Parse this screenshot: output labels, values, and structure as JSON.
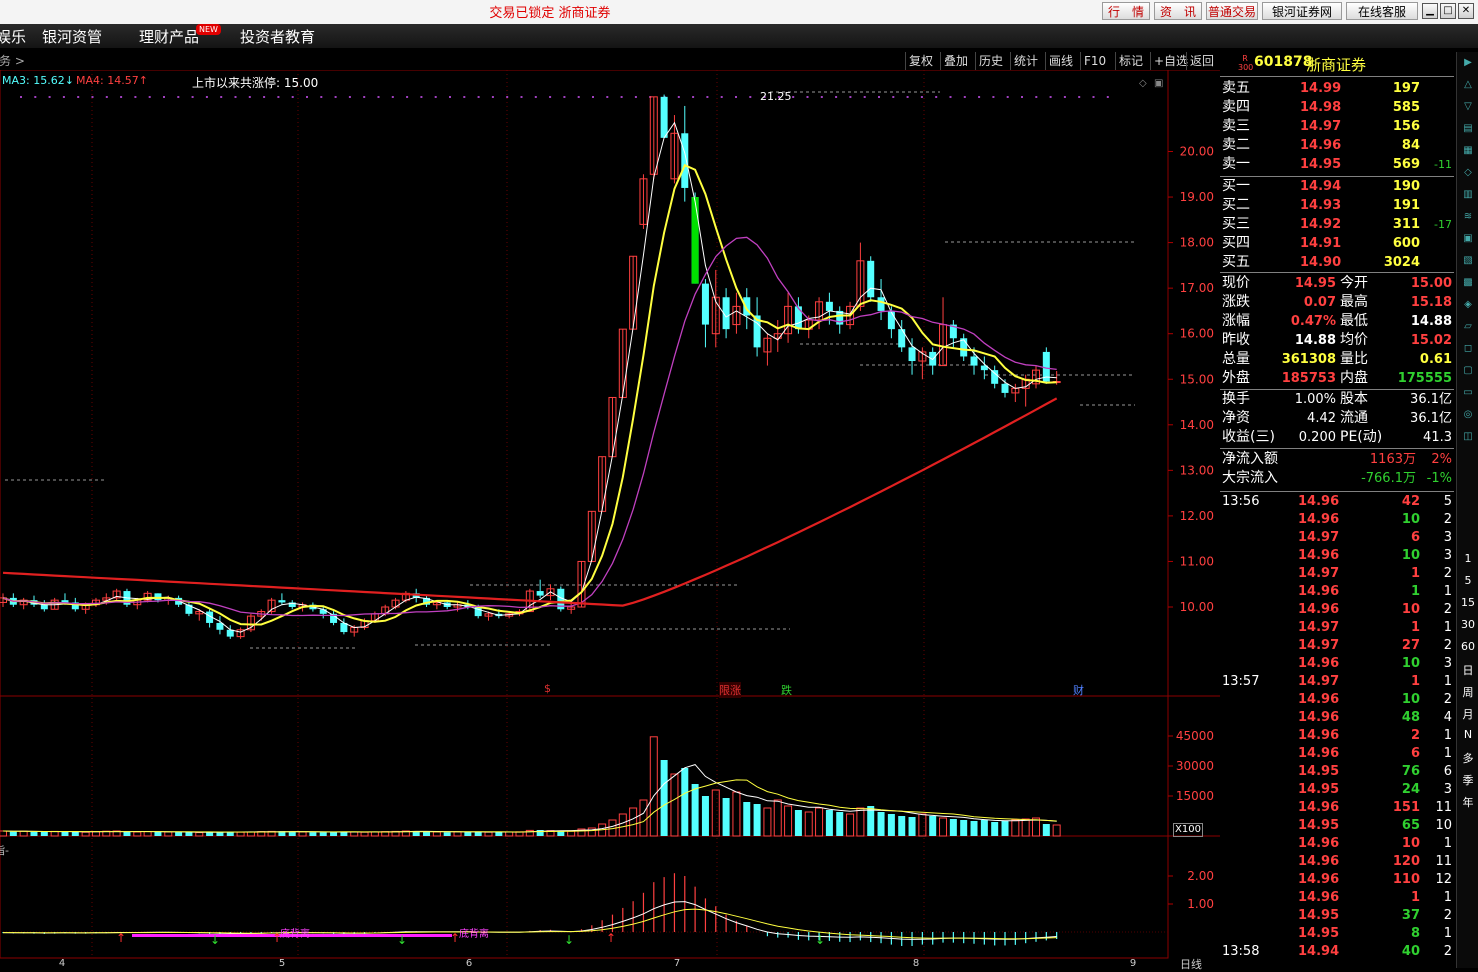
{
  "window": {
    "title": "交易已锁定  浙商证券",
    "buttons": [
      "行　情",
      "资　讯",
      "普通交易",
      "银河证券网",
      "在线客服"
    ]
  },
  "menu": {
    "items": [
      "娱乐",
      "银河资管",
      "理财产品",
      "投资者教育"
    ],
    "new_badge": "NEW"
  },
  "toolbar": {
    "left": "务 >",
    "items": [
      "复权",
      "叠加",
      "历史",
      "统计",
      "画线",
      "F10",
      "标记",
      "+自选",
      "返回"
    ]
  },
  "indicators": {
    "ma3": "MA3: 15.62",
    "ma3_arrow": "↓",
    "ma4": "MA4: 14.57",
    "ma4_arrow": "↑",
    "limit_up": "上市以来共涨停: 15.00",
    "peak": "21.25",
    "volume_unit": "X100",
    "macd_label": "指-",
    "period": "日线"
  },
  "events": [
    {
      "label": "$",
      "color": "#e03030"
    },
    {
      "label": "限涨",
      "color": "#e03030"
    },
    {
      "label": "跌",
      "color": "#30d030"
    },
    {
      "label": "财",
      "color": "#5080ff"
    }
  ],
  "annotations": [
    "底背离",
    "底背离"
  ],
  "colors": {
    "up": "#ff4040",
    "down": "#54ffff",
    "ma_white": "#ffffff",
    "ma_yellow": "#ffff40",
    "ma_magenta": "#c040c0",
    "ma_red": "#e02020"
  },
  "chart_data": {
    "type": "candlestick",
    "price_axis": {
      "ticks": [
        "20.00",
        "19.00",
        "18.00",
        "17.00",
        "16.00",
        "15.00",
        "14.00",
        "13.00",
        "12.00",
        "11.00",
        "10.00"
      ]
    },
    "volume_axis": {
      "ticks": [
        "45000",
        "30000",
        "15000"
      ]
    },
    "macd_axis": {
      "ticks": [
        "2.00",
        "1.00"
      ]
    },
    "x_labels": [
      "4",
      "5",
      "6",
      "7",
      "8",
      "9"
    ],
    "candles": [
      [
        10.1,
        10.3,
        10.0,
        10.2
      ],
      [
        10.2,
        10.3,
        10.0,
        10.05
      ],
      [
        10.05,
        10.2,
        9.95,
        10.15
      ],
      [
        10.15,
        10.25,
        10.0,
        10.05
      ],
      [
        10.05,
        10.15,
        9.9,
        9.95
      ],
      [
        9.95,
        10.2,
        9.95,
        10.15
      ],
      [
        10.15,
        10.3,
        10.05,
        10.1
      ],
      [
        10.1,
        10.2,
        9.9,
        9.95
      ],
      [
        9.95,
        10.1,
        9.85,
        10.05
      ],
      [
        10.05,
        10.2,
        10.0,
        10.15
      ],
      [
        10.15,
        10.3,
        10.05,
        10.2
      ],
      [
        10.2,
        10.4,
        10.15,
        10.35
      ],
      [
        10.35,
        10.4,
        10.0,
        10.05
      ],
      [
        10.05,
        10.2,
        9.95,
        10.15
      ],
      [
        10.15,
        10.35,
        10.1,
        10.3
      ],
      [
        10.3,
        10.3,
        10.1,
        10.15
      ],
      [
        10.15,
        10.25,
        10.05,
        10.2
      ],
      [
        10.2,
        10.25,
        10.0,
        10.05
      ],
      [
        10.05,
        10.1,
        9.8,
        9.85
      ],
      [
        9.85,
        9.95,
        9.7,
        9.9
      ],
      [
        9.9,
        9.95,
        9.55,
        9.65
      ],
      [
        9.65,
        9.8,
        9.4,
        9.5
      ],
      [
        9.5,
        9.6,
        9.3,
        9.35
      ],
      [
        9.35,
        9.55,
        9.3,
        9.5
      ],
      [
        9.5,
        9.85,
        9.45,
        9.8
      ],
      [
        9.8,
        9.95,
        9.7,
        9.9
      ],
      [
        9.9,
        10.2,
        9.85,
        10.15
      ],
      [
        10.15,
        10.3,
        10.05,
        10.1
      ],
      [
        10.1,
        10.15,
        9.95,
        10.0
      ],
      [
        10.0,
        10.1,
        9.9,
        10.05
      ],
      [
        10.05,
        10.1,
        9.9,
        9.95
      ],
      [
        9.95,
        10.0,
        9.75,
        9.85
      ],
      [
        9.85,
        9.95,
        9.6,
        9.65
      ],
      [
        9.65,
        9.75,
        9.4,
        9.45
      ],
      [
        9.45,
        9.6,
        9.35,
        9.55
      ],
      [
        9.55,
        9.75,
        9.5,
        9.7
      ],
      [
        9.7,
        9.9,
        9.65,
        9.85
      ],
      [
        9.85,
        10.05,
        9.8,
        10.0
      ],
      [
        10.0,
        10.2,
        9.95,
        10.15
      ],
      [
        10.15,
        10.35,
        10.1,
        10.3
      ],
      [
        10.3,
        10.4,
        10.1,
        10.2
      ],
      [
        10.2,
        10.25,
        10.0,
        10.05
      ],
      [
        10.05,
        10.15,
        9.95,
        10.1
      ],
      [
        10.1,
        10.15,
        9.95,
        10.0
      ],
      [
        10.0,
        10.1,
        9.9,
        10.05
      ],
      [
        10.05,
        10.15,
        9.95,
        10.0
      ],
      [
        10.0,
        10.05,
        9.75,
        9.8
      ],
      [
        9.8,
        9.9,
        9.7,
        9.85
      ],
      [
        9.85,
        9.95,
        9.75,
        9.8
      ],
      [
        9.8,
        9.9,
        9.75,
        9.85
      ],
      [
        9.85,
        9.95,
        9.8,
        9.9
      ],
      [
        9.9,
        10.4,
        9.9,
        10.35
      ],
      [
        10.35,
        10.6,
        10.2,
        10.25
      ],
      [
        10.25,
        10.5,
        10.15,
        10.4
      ],
      [
        10.4,
        10.45,
        9.9,
        9.95
      ],
      [
        9.95,
        10.1,
        9.85,
        10.0
      ],
      [
        10.0,
        11.0,
        10.0,
        11.0
      ],
      [
        11.0,
        12.1,
        11.0,
        12.1
      ],
      [
        12.1,
        13.3,
        12.1,
        13.3
      ],
      [
        13.3,
        14.6,
        13.3,
        14.6
      ],
      [
        14.6,
        16.1,
        14.6,
        16.1
      ],
      [
        16.1,
        17.7,
        16.1,
        17.7
      ],
      [
        18.4,
        19.5,
        18.3,
        19.4
      ],
      [
        19.5,
        21.2,
        19.4,
        21.2
      ],
      [
        21.2,
        21.25,
        20.3,
        20.3
      ],
      [
        19.4,
        20.8,
        19.3,
        20.4
      ],
      [
        20.4,
        21.0,
        18.9,
        19.2
      ],
      [
        19.0,
        19.1,
        17.1,
        17.1
      ],
      [
        17.1,
        17.2,
        15.7,
        16.2
      ],
      [
        16.0,
        17.4,
        15.7,
        16.8
      ],
      [
        16.8,
        17.0,
        15.9,
        16.1
      ],
      [
        16.2,
        16.9,
        16.0,
        16.6
      ],
      [
        16.8,
        17.0,
        16.1,
        16.4
      ],
      [
        16.4,
        16.8,
        15.5,
        15.7
      ],
      [
        15.6,
        16.0,
        15.3,
        15.9
      ],
      [
        15.9,
        16.3,
        15.6,
        16.0
      ],
      [
        16.0,
        16.9,
        15.8,
        16.6
      ],
      [
        16.6,
        16.8,
        16.0,
        16.1
      ],
      [
        16.1,
        16.4,
        15.9,
        16.3
      ],
      [
        16.3,
        16.8,
        16.1,
        16.7
      ],
      [
        16.7,
        16.9,
        16.2,
        16.5
      ],
      [
        16.5,
        16.6,
        16.0,
        16.2
      ],
      [
        16.2,
        16.7,
        16.1,
        16.6
      ],
      [
        16.6,
        18.0,
        16.5,
        17.6
      ],
      [
        17.6,
        17.7,
        16.7,
        16.8
      ],
      [
        16.8,
        17.2,
        16.3,
        16.5
      ],
      [
        16.5,
        16.6,
        15.9,
        16.1
      ],
      [
        16.1,
        16.3,
        15.6,
        15.7
      ],
      [
        15.7,
        15.9,
        15.1,
        15.4
      ],
      [
        15.4,
        15.7,
        15.0,
        15.6
      ],
      [
        15.6,
        15.7,
        15.1,
        15.3
      ],
      [
        15.3,
        16.8,
        15.3,
        16.2
      ],
      [
        16.2,
        16.3,
        15.7,
        15.9
      ],
      [
        15.9,
        16.0,
        15.4,
        15.5
      ],
      [
        15.5,
        15.7,
        15.1,
        15.3
      ],
      [
        15.3,
        15.5,
        15.0,
        15.2
      ],
      [
        15.2,
        15.3,
        14.8,
        14.9
      ],
      [
        14.9,
        15.0,
        14.6,
        14.7
      ],
      [
        14.7,
        14.9,
        14.5,
        14.8
      ],
      [
        14.8,
        15.1,
        14.4,
        15.0
      ],
      [
        14.9,
        15.3,
        14.8,
        15.2
      ],
      [
        15.6,
        15.7,
        14.9,
        14.95
      ],
      [
        14.95,
        15.18,
        14.88,
        14.95
      ]
    ],
    "volumes": [
      25,
      22,
      24,
      21,
      20,
      23,
      24,
      20,
      19,
      22,
      24,
      25,
      21,
      20,
      22,
      21,
      20,
      19,
      18,
      17,
      20,
      22,
      21,
      19,
      20,
      22,
      23,
      24,
      21,
      20,
      19,
      18,
      21,
      22,
      20,
      19,
      20,
      22,
      23,
      25,
      24,
      21,
      20,
      19,
      21,
      22,
      20,
      19,
      18,
      20,
      21,
      28,
      30,
      27,
      26,
      24,
      35,
      40,
      60,
      80,
      110,
      140,
      180,
      496,
      380,
      310,
      340,
      260,
      200,
      230,
      190,
      220,
      170,
      160,
      140,
      180,
      150,
      130,
      120,
      140,
      130,
      120,
      110,
      140,
      150,
      120,
      110,
      100,
      95,
      110,
      100,
      90,
      85,
      80,
      75,
      80,
      70,
      75,
      80,
      85,
      90,
      60,
      55
    ],
    "macd": [
      -0.04,
      -0.05,
      -0.05,
      -0.06,
      -0.07,
      -0.06,
      -0.05,
      -0.06,
      -0.06,
      -0.05,
      -0.04,
      -0.02,
      -0.03,
      -0.03,
      -0.02,
      -0.02,
      -0.02,
      -0.03,
      -0.04,
      -0.05,
      -0.07,
      -0.09,
      -0.11,
      -0.11,
      -0.09,
      -0.07,
      -0.04,
      -0.03,
      -0.03,
      -0.03,
      -0.04,
      -0.05,
      -0.07,
      -0.09,
      -0.09,
      -0.07,
      -0.05,
      -0.02,
      0.01,
      0.03,
      0.03,
      0.02,
      0.02,
      0.01,
      0.01,
      0.01,
      -0.01,
      -0.01,
      -0.02,
      -0.02,
      -0.01,
      0.04,
      0.07,
      0.08,
      0.03,
      0.01,
      0.1,
      0.24,
      0.42,
      0.62,
      0.86,
      1.1,
      1.4,
      1.78,
      1.96,
      2.1,
      2.0,
      1.62,
      1.2,
      0.92,
      0.62,
      0.4,
      0.22,
      0.0,
      -0.15,
      -0.2,
      -0.2,
      -0.28,
      -0.3,
      -0.3,
      -0.32,
      -0.35,
      -0.36,
      -0.3,
      -0.36,
      -0.4,
      -0.45,
      -0.5,
      -0.5,
      -0.45,
      -0.45,
      -0.38,
      -0.38,
      -0.4,
      -0.42,
      -0.45,
      -0.48,
      -0.48,
      -0.46,
      -0.4,
      -0.35,
      -0.3,
      -0.25
    ]
  },
  "quote": {
    "badge": "R 300",
    "code": "601878",
    "name": "浙商证券",
    "sells": [
      {
        "label": "卖五",
        "price": "14.99",
        "vol": "197",
        "chg": ""
      },
      {
        "label": "卖四",
        "price": "14.98",
        "vol": "585",
        "chg": ""
      },
      {
        "label": "卖三",
        "price": "14.97",
        "vol": "156",
        "chg": ""
      },
      {
        "label": "卖二",
        "price": "14.96",
        "vol": "84",
        "chg": ""
      },
      {
        "label": "卖一",
        "price": "14.95",
        "vol": "569",
        "chg": "-11"
      }
    ],
    "buys": [
      {
        "label": "买一",
        "price": "14.94",
        "vol": "190",
        "chg": ""
      },
      {
        "label": "买二",
        "price": "14.93",
        "vol": "191",
        "chg": ""
      },
      {
        "label": "买三",
        "price": "14.92",
        "vol": "311",
        "chg": "-17"
      },
      {
        "label": "买四",
        "price": "14.91",
        "vol": "600",
        "chg": ""
      },
      {
        "label": "买五",
        "price": "14.90",
        "vol": "3024",
        "chg": ""
      }
    ],
    "stats1": [
      {
        "l1": "现价",
        "v1": "14.95",
        "c1": "#ff4040",
        "l2": "今开",
        "v2": "15.00",
        "c2": "#ff4040"
      },
      {
        "l1": "涨跌",
        "v1": "0.07",
        "c1": "#ff4040",
        "l2": "最高",
        "v2": "15.18",
        "c2": "#ff4040"
      },
      {
        "l1": "涨幅",
        "v1": "0.47%",
        "c1": "#ff4040",
        "l2": "最低",
        "v2": "14.88",
        "c2": "#ffffff"
      },
      {
        "l1": "昨收",
        "v1": "14.88",
        "c1": "#ffffff",
        "l2": "均价",
        "v2": "15.02",
        "c2": "#ff4040"
      },
      {
        "l1": "总量",
        "v1": "361308",
        "c1": "#ffff40",
        "l2": "量比",
        "v2": "0.61",
        "c2": "#ffff40"
      },
      {
        "l1": "外盘",
        "v1": "185753",
        "c1": "#ff4040",
        "l2": "内盘",
        "v2": "175555",
        "c2": "#30d030"
      }
    ],
    "stats2": [
      {
        "l1": "换手",
        "v1": "1.00%",
        "l2": "股本",
        "v2": "36.1亿"
      },
      {
        "l1": "净资",
        "v1": "4.42",
        "l2": "流通",
        "v2": "36.1亿"
      },
      {
        "l1": "收益(三)",
        "v1": "0.200",
        "l2": "PE(动)",
        "v2": "41.3"
      }
    ],
    "flow": [
      {
        "label": "净流入额",
        "val": "1163万",
        "pct": "2%",
        "color": "#ff4040"
      },
      {
        "label": "大宗流入",
        "val": "-766.1万",
        "pct": "-1%",
        "color": "#30d030"
      }
    ],
    "ticks": [
      {
        "time": "13:56",
        "price": "14.96",
        "vol": "42",
        "n": "5",
        "c": "#ff4040"
      },
      {
        "time": "",
        "price": "14.96",
        "vol": "10",
        "n": "2",
        "c": "#30d030"
      },
      {
        "time": "",
        "price": "14.97",
        "vol": "6",
        "n": "3",
        "c": "#ff4040"
      },
      {
        "time": "",
        "price": "14.96",
        "vol": "10",
        "n": "3",
        "c": "#30d030"
      },
      {
        "time": "",
        "price": "14.97",
        "vol": "1",
        "n": "2",
        "c": "#ff4040"
      },
      {
        "time": "",
        "price": "14.96",
        "vol": "1",
        "n": "1",
        "c": "#30d030"
      },
      {
        "time": "",
        "price": "14.96",
        "vol": "10",
        "n": "2",
        "c": "#ff4040"
      },
      {
        "time": "",
        "price": "14.97",
        "vol": "1",
        "n": "1",
        "c": "#ff4040"
      },
      {
        "time": "",
        "price": "14.97",
        "vol": "27",
        "n": "2",
        "c": "#ff4040"
      },
      {
        "time": "",
        "price": "14.96",
        "vol": "10",
        "n": "3",
        "c": "#30d030"
      },
      {
        "time": "13:57",
        "price": "14.97",
        "vol": "1",
        "n": "1",
        "c": "#ff4040"
      },
      {
        "time": "",
        "price": "14.96",
        "vol": "10",
        "n": "2",
        "c": "#30d030"
      },
      {
        "time": "",
        "price": "14.96",
        "vol": "48",
        "n": "4",
        "c": "#30d030"
      },
      {
        "time": "",
        "price": "14.96",
        "vol": "2",
        "n": "1",
        "c": "#ff4040"
      },
      {
        "time": "",
        "price": "14.96",
        "vol": "6",
        "n": "1",
        "c": "#ff4040"
      },
      {
        "time": "",
        "price": "14.95",
        "vol": "76",
        "n": "6",
        "c": "#30d030"
      },
      {
        "time": "",
        "price": "14.95",
        "vol": "24",
        "n": "3",
        "c": "#30d030"
      },
      {
        "time": "",
        "price": "14.96",
        "vol": "151",
        "n": "11",
        "c": "#ff4040"
      },
      {
        "time": "",
        "price": "14.95",
        "vol": "65",
        "n": "10",
        "c": "#30d030"
      },
      {
        "time": "",
        "price": "14.96",
        "vol": "10",
        "n": "1",
        "c": "#ff4040"
      },
      {
        "time": "",
        "price": "14.96",
        "vol": "120",
        "n": "11",
        "c": "#ff4040"
      },
      {
        "time": "",
        "price": "14.96",
        "vol": "110",
        "n": "12",
        "c": "#ff4040"
      },
      {
        "time": "",
        "price": "14.96",
        "vol": "1",
        "n": "1",
        "c": "#ff4040"
      },
      {
        "time": "",
        "price": "14.95",
        "vol": "37",
        "n": "2",
        "c": "#30d030"
      },
      {
        "time": "",
        "price": "14.95",
        "vol": "8",
        "n": "1",
        "c": "#30d030"
      },
      {
        "time": "13:58",
        "price": "14.94",
        "vol": "40",
        "n": "2",
        "c": "#30d030"
      }
    ]
  },
  "sidebar": {
    "periods": [
      "1",
      "5",
      "15",
      "30",
      "60",
      "日",
      "周",
      "月",
      "N",
      "多",
      "季",
      "年"
    ]
  }
}
